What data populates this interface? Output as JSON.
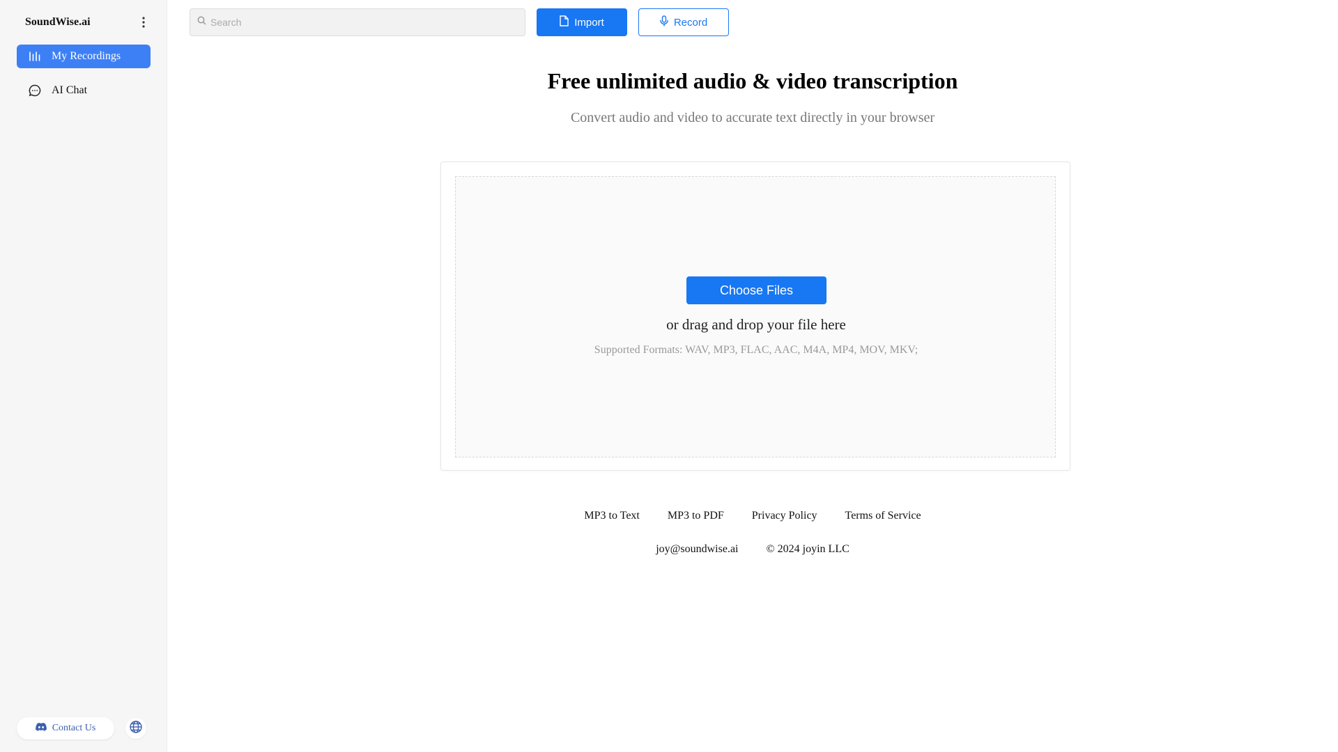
{
  "sidebar": {
    "brand": "SoundWise.ai",
    "items": [
      {
        "label": "My Recordings",
        "icon": "audio-bars-icon",
        "active": true
      },
      {
        "label": "AI Chat",
        "icon": "chat-bubble-icon",
        "active": false
      }
    ],
    "contact_label": "Contact Us",
    "contact_icon": "discord-icon",
    "language_icon": "globe-icon"
  },
  "topbar": {
    "search_placeholder": "Search",
    "search_value": "",
    "import_label": "Import",
    "record_label": "Record"
  },
  "hero": {
    "title": "Free unlimited audio & video transcription",
    "subtitle": "Convert audio and video to accurate text directly in your browser"
  },
  "upload": {
    "choose_label": "Choose Files",
    "drag_text": "or drag and drop your file here",
    "formats_text": "Supported Formats: WAV, MP3, FLAC, AAC, M4A, MP4, MOV, MKV;"
  },
  "footer": {
    "links": [
      "MP3 to Text",
      "MP3 to PDF",
      "Privacy Policy",
      "Terms of Service"
    ],
    "email": "joy@soundwise.ai",
    "copyright": "© 2024 joyin LLC"
  },
  "colors": {
    "accent": "#1877f2",
    "nav_active": "#3d80f5",
    "sidebar_bg": "#f6f6f6"
  }
}
